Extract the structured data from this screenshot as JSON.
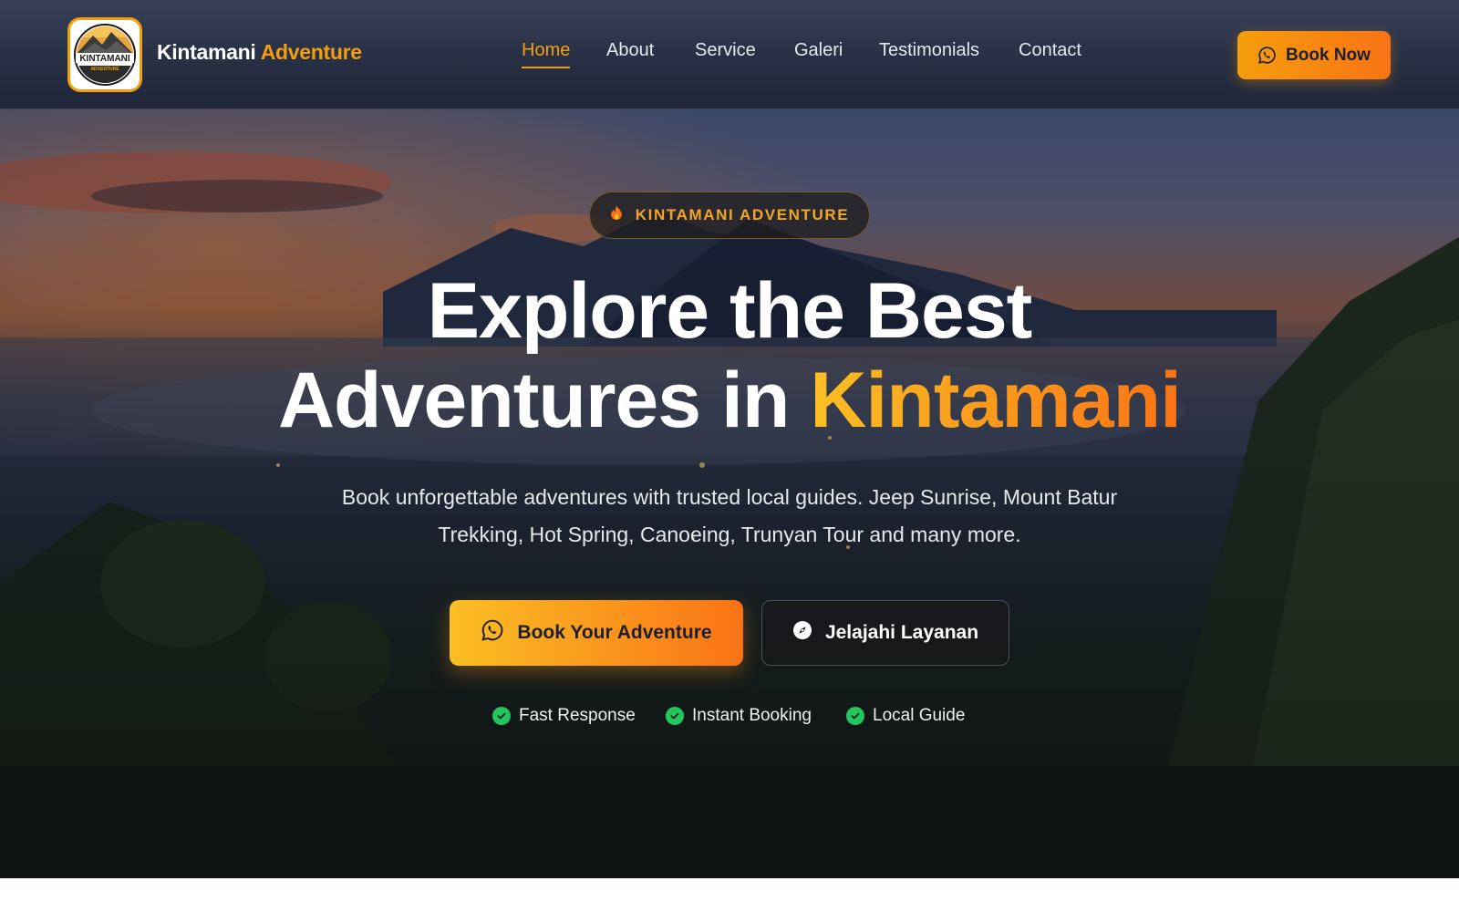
{
  "nav": {
    "logo_text": "KINTAMANI",
    "logo_subtext": "ADVENTURE",
    "brand_primary": "Kintamani",
    "brand_accent": "Adventure",
    "menu": [
      {
        "label": "Home",
        "active": true
      },
      {
        "label": "About",
        "active": false
      },
      {
        "label": "Service",
        "active": false
      },
      {
        "label": "Galeri",
        "active": false
      },
      {
        "label": "Testimonials",
        "active": false
      },
      {
        "label": "Contact",
        "active": false
      }
    ],
    "book_now_label": "Book Now",
    "book_now_icon": "whatsapp-icon"
  },
  "hero": {
    "badge_icon": "fire-icon",
    "badge_label": "KINTAMANI ADVENTURE",
    "headline_line1": "Explore the Best",
    "headline_line2_prefix": "Adventures in ",
    "headline_line2_accent": "Kintamani",
    "subtitle": "Book unforgettable adventures with trusted local guides. Jeep Sunrise, Mount Batur Trekking, Hot Spring, Canoeing, Trunyan Tour and many more.",
    "cta_primary": {
      "label": "Book Your Adventure",
      "icon": "whatsapp-icon"
    },
    "cta_secondary": {
      "label": "Jelajahi Layanan",
      "icon": "compass-icon"
    },
    "features": [
      {
        "label": "Fast Response",
        "icon": "check-circle-icon"
      },
      {
        "label": "Instant Booking",
        "icon": "check-circle-icon"
      },
      {
        "label": "Local Guide",
        "icon": "check-circle-icon"
      }
    ]
  },
  "colors": {
    "accent_orange": "#f59e0b",
    "accent_deep_orange": "#f97316",
    "nav_bg": "#2a3248",
    "success_green": "#22c55e"
  }
}
